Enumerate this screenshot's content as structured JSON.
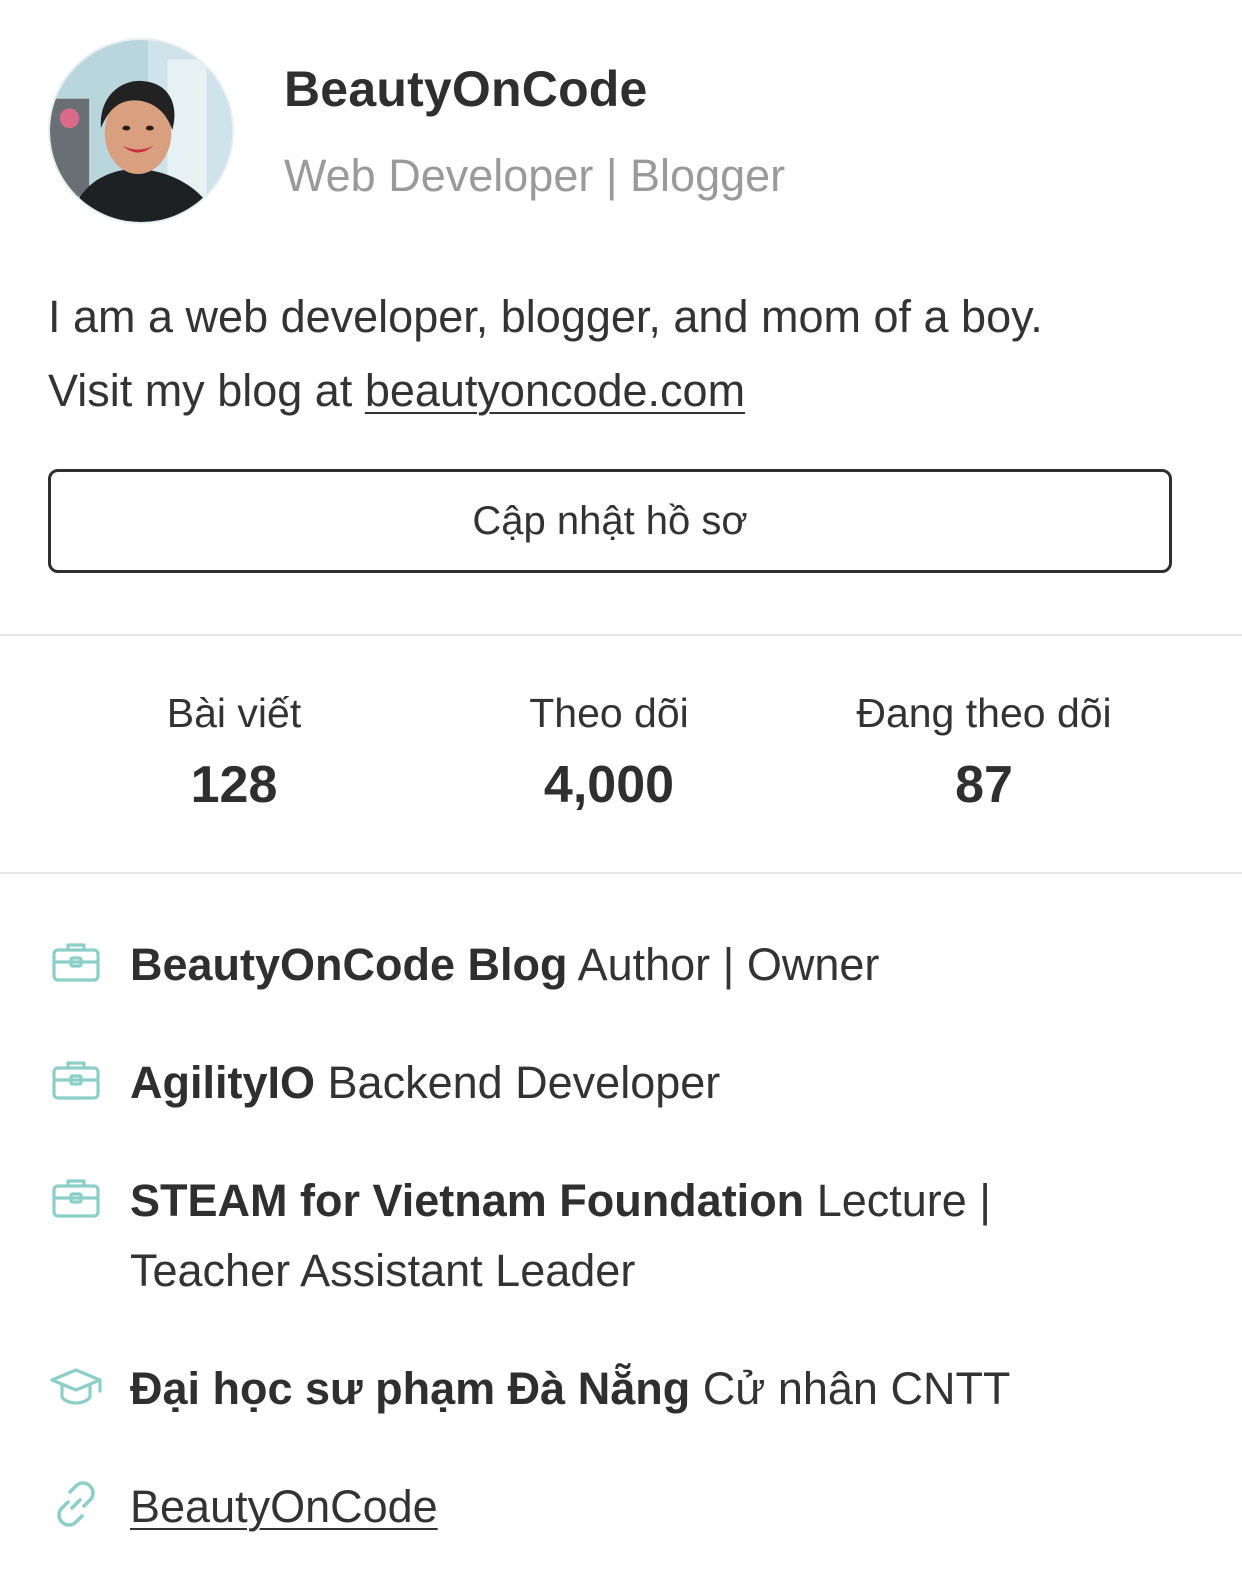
{
  "profile": {
    "name": "BeautyOnCode",
    "headline": "Web Developer | Blogger",
    "bio_line1": "I am a web developer, blogger, and mom of a boy.",
    "bio_line2_prefix": "Visit my blog at ",
    "bio_link": "beautyoncode.com"
  },
  "actions": {
    "edit_profile_label": "Cập nhật hồ sơ"
  },
  "stats": [
    {
      "label": "Bài viết",
      "value": "128"
    },
    {
      "label": "Theo dõi",
      "value": "4,000"
    },
    {
      "label": "Đang theo dõi",
      "value": "87"
    }
  ],
  "info": {
    "work": [
      {
        "org": "BeautyOnCode Blog",
        "role": "Author | Owner"
      },
      {
        "org": "AgilityIO",
        "role": "Backend Developer"
      },
      {
        "org": "STEAM for Vietnam Foundation",
        "role": "Lecture | Teacher Assistant Leader"
      }
    ],
    "education": {
      "school": "Đại học sư phạm Đà Nẵng",
      "degree": "Cử nhân CNTT"
    },
    "website": {
      "label": "BeautyOnCode"
    }
  },
  "colors": {
    "icon_accent": "#8ccfc8",
    "text_primary": "#2f2f2f",
    "text_secondary": "#9a9a9a",
    "divider": "#e8e8e8"
  },
  "icons": {
    "work": "briefcase-icon",
    "education": "graduation-cap-icon",
    "website": "link-icon"
  }
}
